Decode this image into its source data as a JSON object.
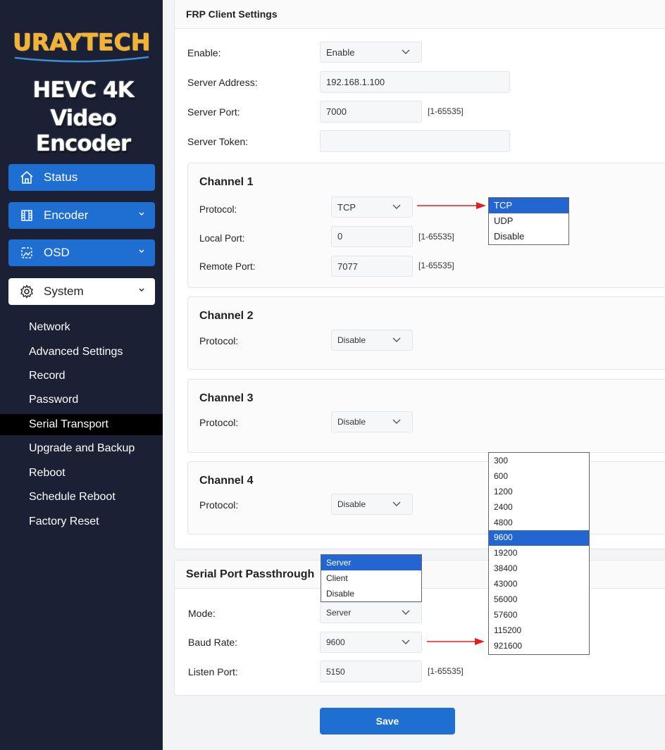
{
  "brand": {
    "logo_text": "URAYTECH",
    "product_line1": "HEVC 4K",
    "product_line2": "Video Encoder",
    "logo_color": "#f2b233"
  },
  "sidebar": {
    "nav": [
      {
        "label": "Status",
        "icon": "home-icon"
      },
      {
        "label": "Encoder",
        "icon": "film-icon"
      },
      {
        "label": "OSD",
        "icon": "image-icon"
      },
      {
        "label": "System",
        "icon": "gear-icon"
      }
    ],
    "system_items": [
      "Network",
      "Advanced Settings",
      "Record",
      "Password",
      "Serial Transport",
      "Upgrade and Backup",
      "Reboot",
      "Schedule Reboot",
      "Factory Reset"
    ],
    "active_item": "Serial Transport",
    "accent_color": "#1f6fd2"
  },
  "frp": {
    "title": "FRP Client Settings",
    "enable_label": "Enable:",
    "enable_value": "Enable",
    "server_address_label": "Server Address:",
    "server_address_value": "192.168.1.100",
    "server_port_label": "Server Port:",
    "server_port_value": "7000",
    "server_port_range": "[1-65535]",
    "server_token_label": "Server Token:",
    "server_token_value": "",
    "channel1": {
      "title": "Channel 1",
      "protocol_label": "Protocol:",
      "protocol_value": "TCP",
      "local_port_label": "Local Port:",
      "local_port_value": "0",
      "local_port_range": "[1-65535]",
      "remote_port_label": "Remote Port:",
      "remote_port_value": "7077",
      "remote_port_range": "[1-65535]",
      "protocol_options": [
        "TCP",
        "UDP",
        "Disable"
      ]
    },
    "channel2": {
      "title": "Channel 2",
      "protocol_label": "Protocol:",
      "protocol_value": "Disable"
    },
    "channel3": {
      "title": "Channel 3",
      "protocol_label": "Protocol:",
      "protocol_value": "Disable"
    },
    "channel4": {
      "title": "Channel 4",
      "protocol_label": "Protocol:",
      "protocol_value": "Disable"
    }
  },
  "serial": {
    "title": "Serial Port Passthrough",
    "mode_label": "Mode:",
    "mode_value": "Server",
    "mode_options": [
      "Server",
      "Client",
      "Disable"
    ],
    "baud_label": "Baud Rate:",
    "baud_value": "9600",
    "baud_options": [
      "300",
      "600",
      "1200",
      "2400",
      "4800",
      "9600",
      "19200",
      "38400",
      "43000",
      "56000",
      "57600",
      "115200",
      "921600"
    ],
    "listen_port_label": "Listen Port:",
    "listen_port_value": "5150",
    "listen_port_range": "[1-65535]"
  },
  "save_label": "Save",
  "annotation_arrow_color": "#e0201c"
}
